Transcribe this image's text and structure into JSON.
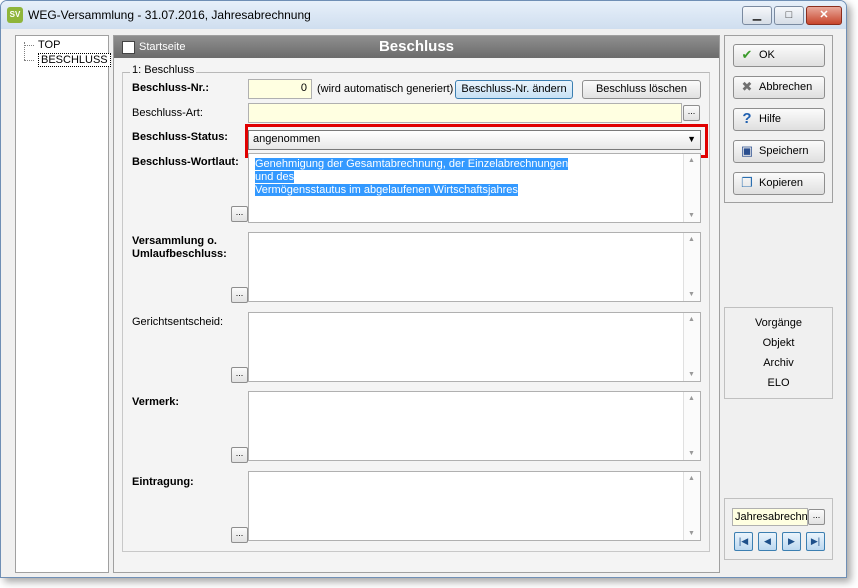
{
  "window": {
    "title": "WEG-Versammlung - 31.07.2016,  Jahresabrechnung",
    "app_icon_text": "SV",
    "minimize_label": "▁",
    "maximize_label": "□",
    "close_label": "✕"
  },
  "tree": {
    "items": [
      {
        "label": "TOP"
      },
      {
        "label": "BESCHLUSS",
        "selected": true
      }
    ]
  },
  "header": {
    "startseite_label": "Startseite",
    "title": "Beschluss"
  },
  "form": {
    "group_label": "1: Beschluss",
    "nr_label": "Beschluss-Nr.:",
    "nr_value": "0",
    "nr_hint": "(wird automatisch generiert)",
    "change_nr_button": "Beschluss-Nr. ändern",
    "delete_button": "Beschluss löschen",
    "art_label": "Beschluss-Art:",
    "art_value": "",
    "status_label": "Beschluss-Status:",
    "status_value": "angenommen",
    "wortlaut_label": "Beschluss-Wortlaut:",
    "wortlaut_line1": "Genehmigung der Gesamtabrechnung, der Einzelabrechnungen und des",
    "wortlaut_line2": "Vermögensstautus im abgelaufenen Wirtschaftsjahres",
    "versammlung_label_1": "Versammlung o.",
    "versammlung_label_2": "Umlaufbeschluss:",
    "gericht_label": "Gerichtsentscheid:",
    "vermerk_label": "Vermerk:",
    "eintragung_label": "Eintragung:",
    "dots_label": "..."
  },
  "actions": {
    "ok": "OK",
    "abbrechen": "Abbrechen",
    "hilfe": "Hilfe",
    "speichern": "Speichern",
    "kopieren": "Kopieren"
  },
  "links": [
    "Vorgänge",
    "Objekt",
    "Archiv",
    "ELO"
  ],
  "nav": {
    "field_value": "Jahresabrechnung",
    "first": "|◀",
    "prev": "◀",
    "next": "▶",
    "last": "▶|"
  },
  "colors": {
    "highlight_box": "#e00000",
    "selection": "#3399ff",
    "field_bg": "#ffffe1"
  }
}
